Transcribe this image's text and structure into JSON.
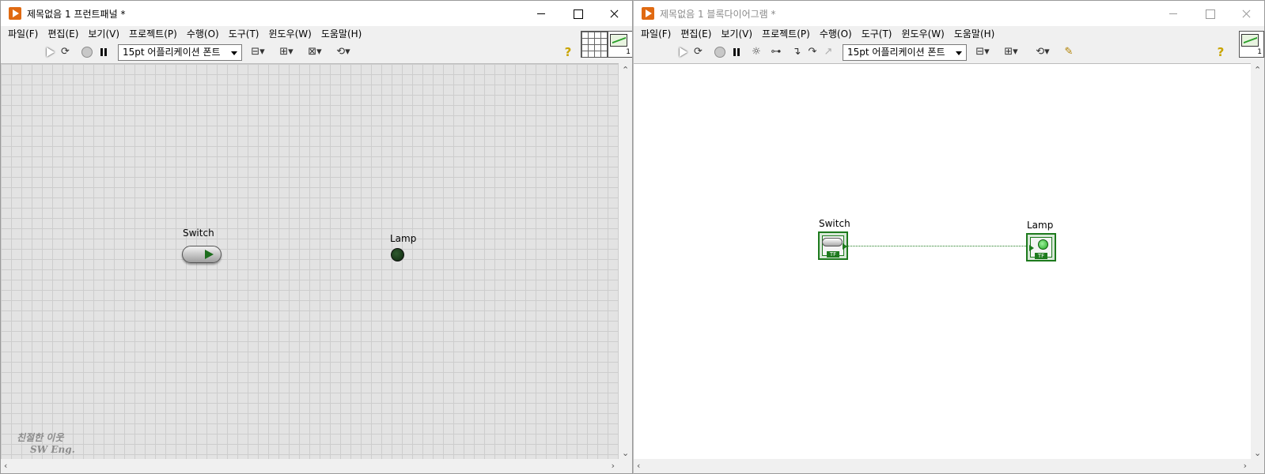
{
  "front_panel": {
    "title": "제목없음 1 프런트패널 *",
    "menus": [
      "파일(F)",
      "편집(E)",
      "보기(V)",
      "프로젝트(P)",
      "수행(O)",
      "도구(T)",
      "윈도우(W)",
      "도움말(H)"
    ],
    "font_selector": "15pt 어플리케이션 폰트",
    "connector_pane_number": "1",
    "controls": {
      "switch_label": "Switch",
      "lamp_label": "Lamp"
    },
    "watermark": {
      "line1": "친절한 이웃",
      "line2": "SW Eng."
    }
  },
  "block_diagram": {
    "title": "제목없음 1 블록다이어그램 *",
    "menus": [
      "파일(F)",
      "편집(E)",
      "보기(V)",
      "프로젝트(P)",
      "수행(O)",
      "도구(T)",
      "윈도우(W)",
      "도움말(H)"
    ],
    "font_selector": "15pt 어플리케이션 폰트",
    "icon_number": "1",
    "terminals": {
      "switch_label": "Switch",
      "lamp_label": "Lamp",
      "type_tag": "TF"
    }
  },
  "colors": {
    "labview_orange": "#e06a12",
    "boolean_green": "#1d7a1d",
    "panel_grid": "#e3e3e3"
  }
}
